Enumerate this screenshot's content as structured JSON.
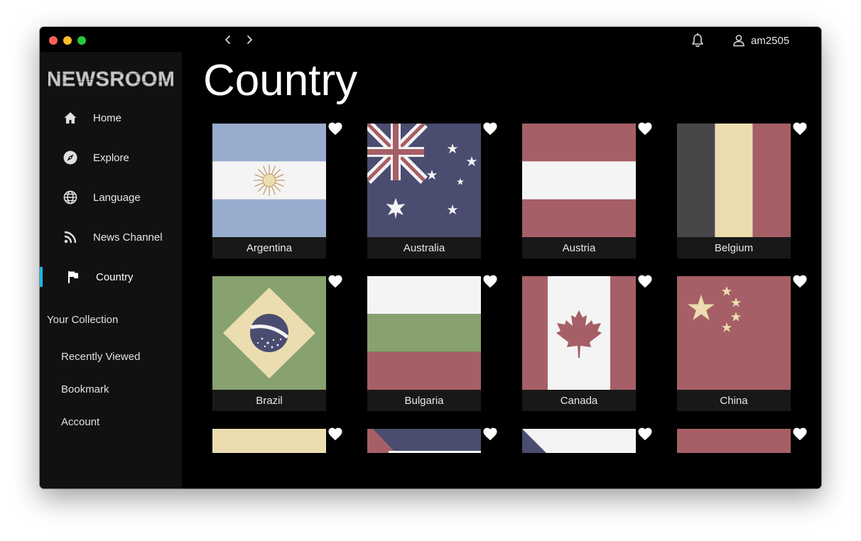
{
  "topbar": {
    "back_icon": "chevron-left-icon",
    "forward_icon": "chevron-right-icon",
    "notification_icon": "bell-icon",
    "user_icon": "user-icon",
    "username": "am2505"
  },
  "sidebar": {
    "logo": "NEWSROOM",
    "nav": [
      {
        "label": "Home",
        "icon": "home-icon"
      },
      {
        "label": "Explore",
        "icon": "compass-icon"
      },
      {
        "label": "Language",
        "icon": "globe-icon"
      },
      {
        "label": "News Channel",
        "icon": "rss-icon"
      },
      {
        "label": "Country",
        "icon": "flag-icon",
        "active": true
      }
    ],
    "collection_title": "Your Collection",
    "collection": [
      {
        "label": "Recently Viewed"
      },
      {
        "label": "Bookmark"
      },
      {
        "label": "Account"
      }
    ]
  },
  "main": {
    "title": "Country",
    "favorite_icon": "heart-icon",
    "countries": [
      {
        "name": "Argentina"
      },
      {
        "name": "Australia"
      },
      {
        "name": "Austria"
      },
      {
        "name": "Belgium"
      },
      {
        "name": "Brazil"
      },
      {
        "name": "Bulgaria"
      },
      {
        "name": "Canada"
      },
      {
        "name": "China"
      }
    ]
  },
  "colors": {
    "accent": "#19b8e8",
    "sidebar_bg": "#111111",
    "content_bg": "#000000",
    "flag_red": "#a65f66",
    "flag_blue": "#4a4d70",
    "flag_light_blue": "#98acce",
    "flag_cream": "#ebddb0",
    "flag_green": "#87a16f",
    "flag_white": "#f4f4f4",
    "flag_dark": "#484649"
  }
}
